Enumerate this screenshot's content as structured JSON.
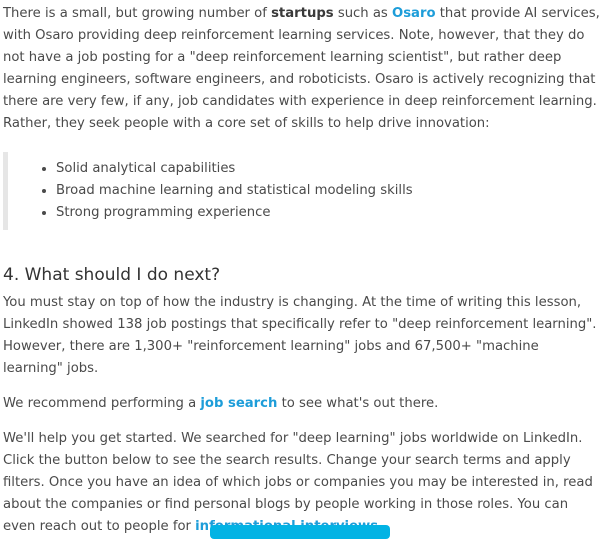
{
  "intro": {
    "t1": "There is a small, but growing number of ",
    "startups": "startups",
    "t2": " such as ",
    "osaro": "Osaro",
    "t3": " that provide AI services, with Osaro providing deep reinforcement learning services. Note, however, that they do not have a job posting for a \"deep reinforcement learning scientist\", but rather deep learning engineers, software engineers, and roboticists. Osaro is actively recognizing that there are very few, if any, job candidates with experience in deep reinforcement learning. Rather, they seek people with a core set of skills to help drive innovation:"
  },
  "skills": [
    "Solid analytical capabilities",
    "Broad machine learning and statistical modeling skills",
    "Strong programming experience"
  ],
  "section": {
    "heading": "4. What should I do next?",
    "p1": "You must stay on top of how the industry is changing. At the time of writing this lesson, LinkedIn showed 138 job postings that specifically refer to \"deep reinforcement learning\". However, there are 1,300+ \"reinforcement learning\" jobs and 67,500+ \"machine learning\" jobs.",
    "p2_before": "We recommend performing a ",
    "p2_link": "job search",
    "p2_after": " to see what's out there.",
    "p3_before": "We'll help you get started. We searched for \"deep learning\" jobs worldwide on LinkedIn. Click the button below to see the search results. Change your search terms and apply filters. Once you have an idea of which jobs or companies you may be interested in, read about the companies or find personal blogs by people working in those roles. You can even reach out to people for ",
    "p3_link": "informational interviews",
    "p3_after": "."
  },
  "colors": {
    "link": "#1d9dd9",
    "button": "#02b3e4"
  }
}
